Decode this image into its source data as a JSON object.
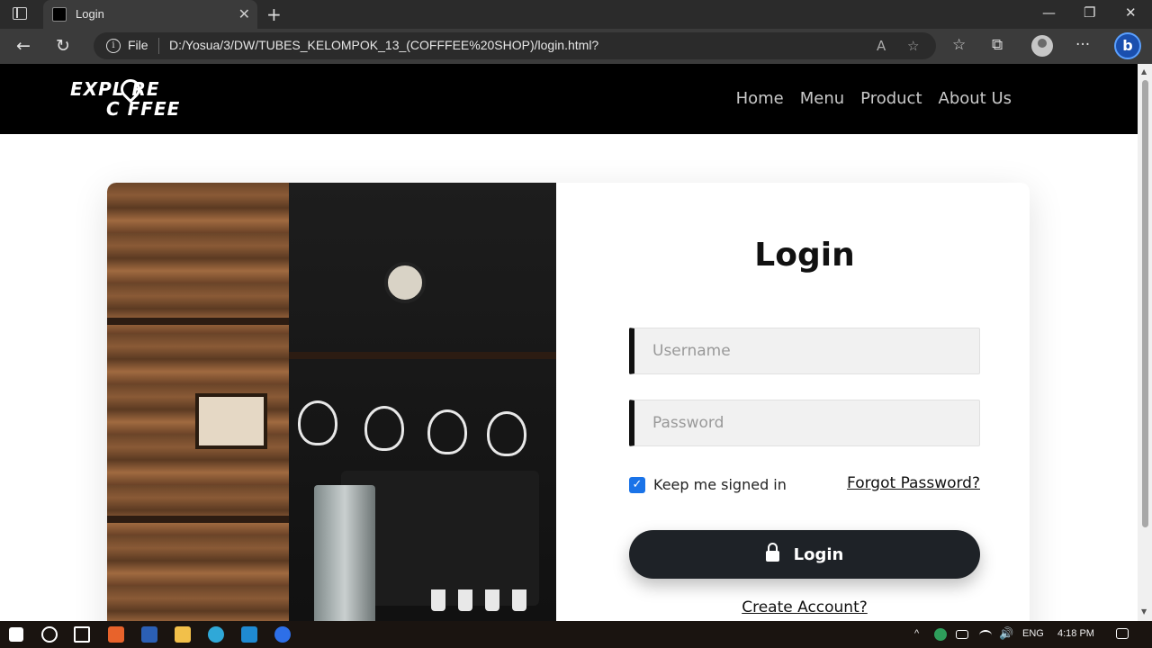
{
  "browser": {
    "tab_title": "Login",
    "url_scheme": "File",
    "url": "D:/Yosua/3/DW/TUBES_KELOMPOK_13_(COFFFEE%20SHOP)/login.html?",
    "bing_label": "b"
  },
  "site": {
    "logo_line1": "EXPL RE",
    "logo_line2": "C FFEE",
    "nav": [
      "Home",
      "Menu",
      "Product",
      "About Us"
    ]
  },
  "form": {
    "title": "Login",
    "username_placeholder": "Username",
    "password_placeholder": "Password",
    "remember_label": "Keep me signed in",
    "remember_checked": true,
    "forgot_label": "Forgot Password?",
    "login_button": "Login",
    "create_account": "Create Account?"
  },
  "taskbar": {
    "language": "ENG",
    "time": "4:18 PM"
  },
  "colors": {
    "header_bg": "#000000",
    "button_bg": "#1e2227",
    "checkbox": "#1a73e8",
    "nav_text": "#c9c9c9"
  }
}
